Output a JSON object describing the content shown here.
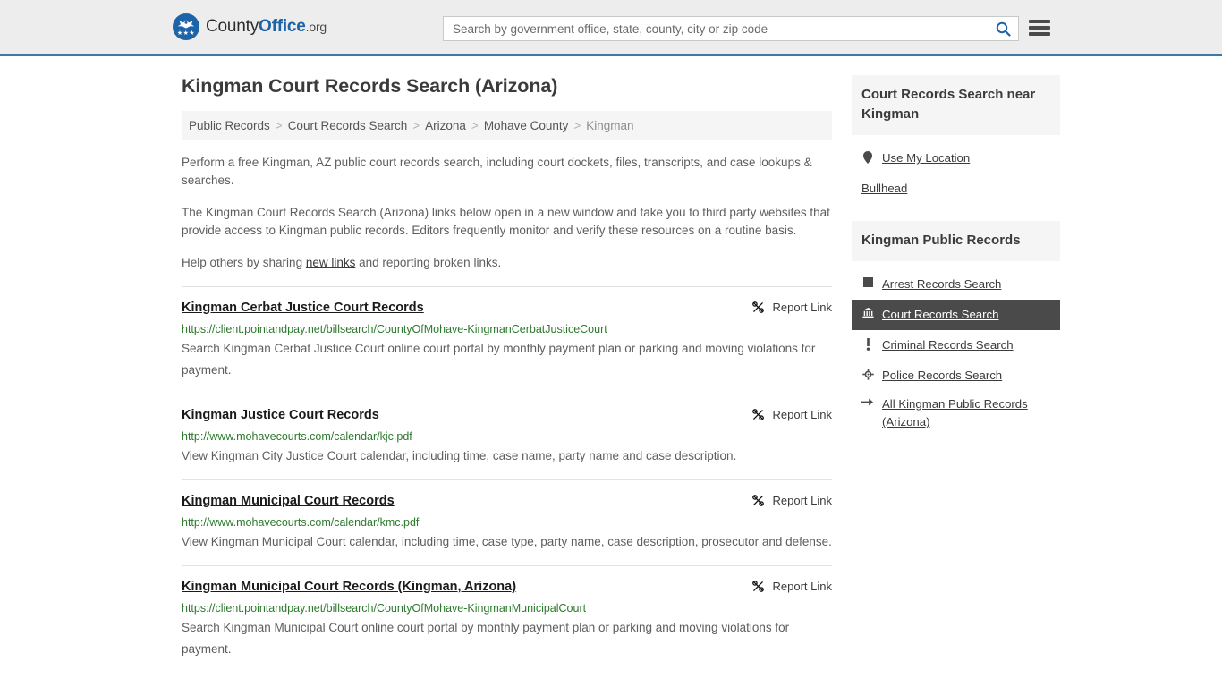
{
  "header": {
    "logo_text_1": "County",
    "logo_text_2": "Office",
    "logo_text_3": ".org",
    "search_placeholder": "Search by government office, state, county, city or zip code",
    "search_value": "",
    "search_icon": "search-icon",
    "menu_icon": "hamburger-menu-icon",
    "accent_color": "#3c78aa",
    "logo_color": "#1d63a8"
  },
  "main": {
    "title": "Kingman Court Records Search (Arizona)",
    "breadcrumb": [
      {
        "label": "Public Records",
        "current": false
      },
      {
        "label": "Court Records Search",
        "current": false
      },
      {
        "label": "Arizona",
        "current": false
      },
      {
        "label": "Mohave County",
        "current": false
      },
      {
        "label": "Kingman",
        "current": true
      }
    ],
    "breadcrumb_separator": ">",
    "intro": {
      "p1": "Perform a free Kingman, AZ public court records search, including court dockets, files, transcripts, and case lookups & searches.",
      "p2": "The Kingman Court Records Search (Arizona) links below open in a new window and take you to third party websites that provide access to Kingman public records. Editors frequently monitor and verify these resources on a routine basis.",
      "p3_before": "Help others by sharing ",
      "p3_link": "new links",
      "p3_after": " and reporting broken links."
    },
    "report_link_label": "Report Link",
    "report_link_icon": "broken-link-icon",
    "results": [
      {
        "title": "Kingman Cerbat Justice Court Records",
        "url": "https://client.pointandpay.net/billsearch/CountyOfMohave-KingmanCerbatJusticeCourt",
        "description": "Search Kingman Cerbat Justice Court online court portal by monthly payment plan or parking and moving violations for payment."
      },
      {
        "title": "Kingman Justice Court Records",
        "url": "http://www.mohavecourts.com/calendar/kjc.pdf",
        "description": "View Kingman City Justice Court calendar, including time, case name, party name and case description."
      },
      {
        "title": "Kingman Municipal Court Records",
        "url": "http://www.mohavecourts.com/calendar/kmc.pdf",
        "description": "View Kingman Municipal Court calendar, including time, case type, party name, case description, prosecutor and defense."
      },
      {
        "title": "Kingman Municipal Court Records (Kingman, Arizona)",
        "url": "https://client.pointandpay.net/billsearch/CountyOfMohave-KingmanMunicipalCourt",
        "description": "Search Kingman Municipal Court online court portal by monthly payment plan or parking and moving violations for payment."
      }
    ]
  },
  "sidebar": {
    "near_box": {
      "heading": "Court Records Search near Kingman",
      "items": [
        {
          "label": "Use My Location",
          "icon": "map-pin-icon"
        },
        {
          "label": "Bullhead",
          "icon": "none"
        }
      ]
    },
    "records_box": {
      "heading": "Kingman Public Records",
      "items": [
        {
          "label": "Arrest Records Search",
          "icon": "square-icon",
          "active": false
        },
        {
          "label": "Court Records Search",
          "icon": "courthouse-icon",
          "active": true
        },
        {
          "label": "Criminal Records Search",
          "icon": "exclamation-icon",
          "active": false
        },
        {
          "label": "Police Records Search",
          "icon": "police-badge-icon",
          "active": false
        },
        {
          "label": "All Kingman Public Records (Arizona)",
          "icon": "arrow-right-icon",
          "active": false
        }
      ]
    },
    "active_bg_color": "#4a4a4a"
  }
}
